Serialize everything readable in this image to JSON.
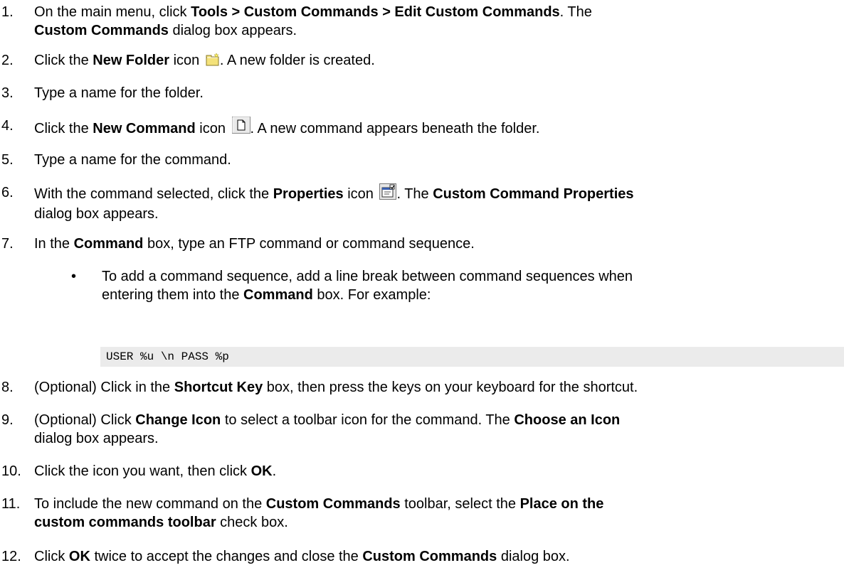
{
  "steps": [
    {
      "num": "1.",
      "parts": [
        "On the main menu, click ",
        "Tools > Custom Commands > Edit Custom Commands",
        ". The "
      ],
      "line2": [
        "Custom Commands",
        " dialog box appears."
      ]
    },
    {
      "num": "2.",
      "parts": [
        "Click the ",
        "New Folder",
        " icon ",
        ". A new folder is created."
      ]
    },
    {
      "num": "3.",
      "text": "Type a name for the folder."
    },
    {
      "num": "4.",
      "parts": [
        "Click the ",
        "New Command",
        " icon ",
        ". A new command appears beneath the folder."
      ]
    },
    {
      "num": "5.",
      "text": "Type a name for the command."
    },
    {
      "num": "6.",
      "parts": [
        "With the command selected, click the ",
        "Properties",
        " icon ",
        ". The ",
        "Custom Command Properties"
      ],
      "line2": [
        "dialog box appears."
      ]
    },
    {
      "num": "7.",
      "parts": [
        "In the ",
        "Command",
        " box, type an FTP command or command sequence."
      ]
    },
    {
      "num": "8.",
      "parts": [
        "(Optional) Click in the ",
        "Shortcut Key",
        " box, then press the keys on your keyboard for the shortcut."
      ]
    },
    {
      "num": "9.",
      "parts": [
        "(Optional) Click ",
        "Change Icon",
        " to select a toolbar icon for the command. The ",
        "Choose an Icon"
      ],
      "line2": [
        "dialog box appears."
      ]
    },
    {
      "num": "10.",
      "parts": [
        "Click the icon you want, then click ",
        "OK",
        "."
      ]
    },
    {
      "num": "11.",
      "parts": [
        "To include the new command on the ",
        "Custom Commands",
        " toolbar, select the ",
        "Place on the"
      ],
      "line2": [
        "custom commands toolbar",
        " check box."
      ]
    },
    {
      "num": "12.",
      "parts": [
        "Click ",
        "OK",
        " twice to accept the changes and close the ",
        "Custom Commands",
        " dialog box."
      ]
    }
  ],
  "bullet": {
    "line1": "To add a command sequence, add a line break between command sequences when",
    "line2_a": "entering them into the ",
    "line2_b": "Command",
    "line2_c": " box. For example:"
  },
  "code": "USER %u \\n PASS %p",
  "icons": {
    "new_folder": "new-folder-icon",
    "new_command": "new-command-icon",
    "properties": "properties-icon"
  },
  "colors": {
    "code_background": "#ebebeb",
    "folder_yellow": "#f4e27a"
  }
}
